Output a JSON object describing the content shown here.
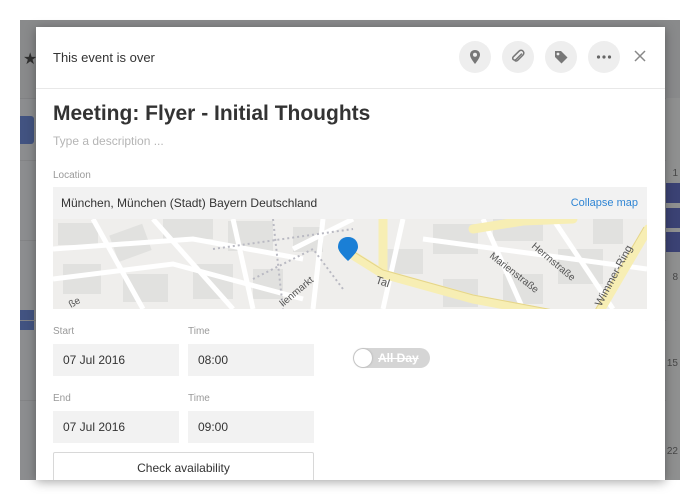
{
  "background": {
    "right_numbers": [
      "1",
      "8",
      "15",
      "22"
    ]
  },
  "header": {
    "status": "This event is over",
    "icons": [
      "location-pin-icon",
      "attachment-icon",
      "tag-icon",
      "more-icon",
      "close-icon"
    ]
  },
  "event": {
    "title": "Meeting: Flyer - Initial Thoughts",
    "description_placeholder": "Type a description ..."
  },
  "location": {
    "label": "Location",
    "value": "München, München (Stadt) Bayern Deutschland",
    "collapse_label": "Collapse map",
    "map_labels": [
      "Tal",
      "Marienstraße",
      "Herrnstraße",
      "Wimmer-Ring",
      "lienmarkt",
      "ße"
    ]
  },
  "start": {
    "date_label": "Start",
    "date": "07 Jul 2016",
    "time_label": "Time",
    "time": "08:00"
  },
  "end": {
    "date_label": "End",
    "date": "07 Jul 2016",
    "time_label": "Time",
    "time": "09:00"
  },
  "all_day": {
    "label": "All Day",
    "on": false
  },
  "check_availability_label": "Check availability",
  "colors": {
    "accent": "#2f85d4",
    "map_pin": "#1a7fd6",
    "map_major_road": "#f7eeb4"
  }
}
